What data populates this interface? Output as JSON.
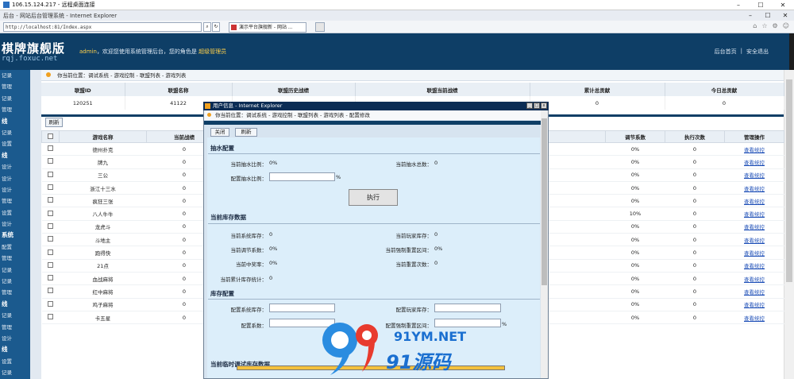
{
  "rdp": {
    "title": "106.15.124.217 - 远程桌面连接"
  },
  "ie": {
    "title": "后台 - 网站后台管理系统 - Internet Explorer",
    "address": "http://localhost:81/Index.aspx",
    "tab": "演示平台旗舰新 - 网站 ..."
  },
  "header": {
    "logo": "棋牌旗舰版",
    "site": "rqj.foxuc.net",
    "welcome_user": "admin",
    "welcome_text": "，欢迎您使用系统管理后台，您的角色是",
    "role": "超级管理员",
    "home_link": "后台首页",
    "sep": "|",
    "logout_link": "安全退出"
  },
  "nav": [
    {
      "label": "记录",
      "h": false
    },
    {
      "label": "管理",
      "h": false
    },
    {
      "label": "记录",
      "h": false
    },
    {
      "label": "管理",
      "h": false
    },
    {
      "label": "线",
      "h": true
    },
    {
      "label": "记录",
      "h": false
    },
    {
      "label": "设置",
      "h": false
    },
    {
      "label": "线",
      "h": true
    },
    {
      "label": "设计",
      "h": false
    },
    {
      "label": "设计",
      "h": false
    },
    {
      "label": "设计",
      "h": false
    },
    {
      "label": "管理",
      "h": false
    },
    {
      "label": "设置",
      "h": false
    },
    {
      "label": "设计",
      "h": false
    },
    {
      "label": "系统",
      "h": true
    },
    {
      "label": "配置",
      "h": false
    },
    {
      "label": "管理",
      "h": false
    },
    {
      "label": "记录",
      "h": false
    },
    {
      "label": "记录",
      "h": false
    },
    {
      "label": "管理",
      "h": false
    },
    {
      "label": "线",
      "h": true
    },
    {
      "label": "记录",
      "h": false
    },
    {
      "label": "管理",
      "h": false
    },
    {
      "label": "设计",
      "h": false
    },
    {
      "label": "线",
      "h": true
    },
    {
      "label": "设置",
      "h": false
    },
    {
      "label": "记录",
      "h": false
    }
  ],
  "crumb": "你当前位置：调试系统 - 游戏控制 - 联盟列表 - 游戏列表",
  "league": {
    "headers": [
      "联盟ID",
      "联盟名称",
      "联盟历史战绩",
      "联盟当前战绩",
      "累计总贡献",
      "今日总贡献"
    ],
    "row": [
      "120251",
      "41122",
      "",
      "",
      "0",
      "0"
    ]
  },
  "refresh_label": "刷新",
  "games": {
    "headers": [
      "",
      "游戏名称",
      "当前战绩",
      "",
      "调节系数",
      "执行次数",
      "管理操作"
    ],
    "rows": [
      {
        "name": "德州扑克",
        "score": "0",
        "coef": "0%",
        "count": "0",
        "op": "查看统控"
      },
      {
        "name": "牌九",
        "score": "0",
        "coef": "0%",
        "count": "0",
        "op": "查看统控"
      },
      {
        "name": "三公",
        "score": "0",
        "coef": "0%",
        "count": "0",
        "op": "查看统控"
      },
      {
        "name": "浙江十三水",
        "score": "0",
        "coef": "0%",
        "count": "0",
        "op": "查看统控"
      },
      {
        "name": "疯狂三张",
        "score": "0",
        "coef": "0%",
        "count": "0",
        "op": "查看统控"
      },
      {
        "name": "八人牛牛",
        "score": "0",
        "coef": "10%",
        "count": "0",
        "op": "查看统控"
      },
      {
        "name": "龙虎斗",
        "score": "0",
        "coef": "0%",
        "count": "0",
        "op": "查看统控"
      },
      {
        "name": "斗地主",
        "score": "0",
        "coef": "0%",
        "count": "0",
        "op": "查看统控"
      },
      {
        "name": "跑得快",
        "score": "0",
        "coef": "0%",
        "count": "0",
        "op": "查看统控"
      },
      {
        "name": "21点",
        "score": "0",
        "coef": "0%",
        "count": "0",
        "op": "查看统控"
      },
      {
        "name": "血战麻将",
        "score": "0",
        "coef": "0%",
        "count": "0",
        "op": "查看统控"
      },
      {
        "name": "红中麻将",
        "score": "0",
        "coef": "0%",
        "count": "0",
        "op": "查看统控"
      },
      {
        "name": "鸡子麻将",
        "score": "0",
        "coef": "0%",
        "count": "0",
        "op": "查看统控"
      },
      {
        "name": "卡五星",
        "score": "0",
        "coef": "0%",
        "count": "0",
        "op": "查看统控"
      }
    ]
  },
  "dialog": {
    "title": "用户信息 - Internet Explorer",
    "crumb": "你当前位置：调试系统 - 游戏控制 - 联盟列表 - 游戏列表 - 配置修改",
    "close": "关闭",
    "refresh": "刷新",
    "sec1": "抽水配置",
    "cur_rate_label": "当前抽水比例：",
    "cur_rate_val": "0%",
    "cur_total_label": "当前抽水总数：",
    "cur_total_val": "0",
    "cfg_rate_label": "配置抽水比例：",
    "percent": "%",
    "exec": "执行",
    "sec2": "当前库存数据",
    "sys_stock_label": "当前系统库存：",
    "sys_stock_val": "0",
    "player_stock_label": "当前玩家库存：",
    "player_stock_val": "0",
    "adj_coef_label": "当前调节系数：",
    "adj_coef_val": "0%",
    "force_reset_label": "当前强制重置区间：",
    "force_reset_val": "0%",
    "win_rate_label": "当前中奖率：",
    "win_rate_val": "0%",
    "reset_count_label": "当前重置次数：",
    "reset_count_val": "0",
    "accum_label": "当前累计库存统计：",
    "accum_val": "0",
    "sec3": "库存配置",
    "cfg_sys_label": "配置系统库存：",
    "cfg_player_label": "配置玩家库存：",
    "cfg_coef_label": "配置系数：",
    "cfg_force_label": "配置强制重置区间：",
    "sec4": "当前临时调试库存数据"
  },
  "watermark": {
    "line1": "91YM.NET",
    "line2": "91源码"
  }
}
